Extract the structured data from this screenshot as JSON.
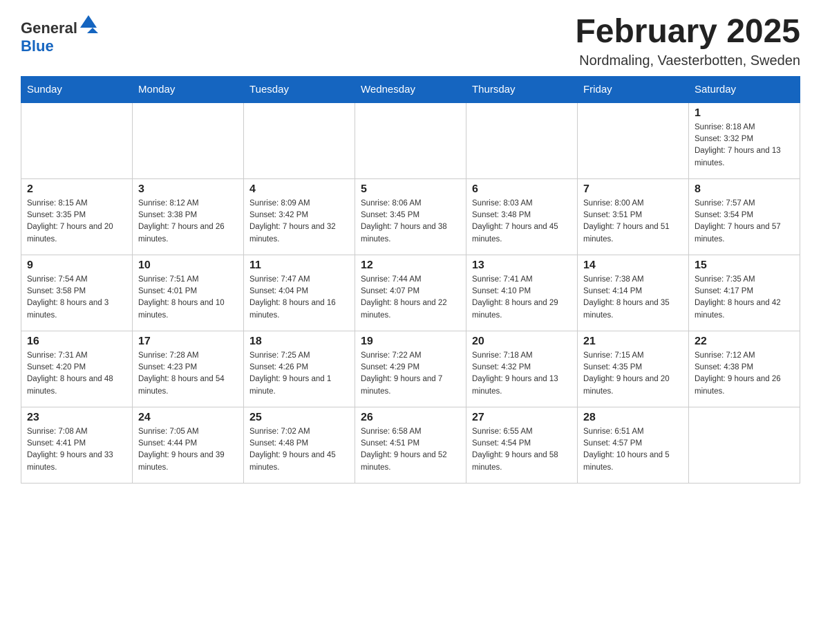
{
  "header": {
    "logo_general": "General",
    "logo_blue": "Blue",
    "month_title": "February 2025",
    "location": "Nordmaling, Vaesterbotten, Sweden"
  },
  "days_of_week": [
    "Sunday",
    "Monday",
    "Tuesday",
    "Wednesday",
    "Thursday",
    "Friday",
    "Saturday"
  ],
  "weeks": [
    [
      {
        "day": "",
        "sunrise": "",
        "sunset": "",
        "daylight": ""
      },
      {
        "day": "",
        "sunrise": "",
        "sunset": "",
        "daylight": ""
      },
      {
        "day": "",
        "sunrise": "",
        "sunset": "",
        "daylight": ""
      },
      {
        "day": "",
        "sunrise": "",
        "sunset": "",
        "daylight": ""
      },
      {
        "day": "",
        "sunrise": "",
        "sunset": "",
        "daylight": ""
      },
      {
        "day": "",
        "sunrise": "",
        "sunset": "",
        "daylight": ""
      },
      {
        "day": "1",
        "sunrise": "Sunrise: 8:18 AM",
        "sunset": "Sunset: 3:32 PM",
        "daylight": "Daylight: 7 hours and 13 minutes."
      }
    ],
    [
      {
        "day": "2",
        "sunrise": "Sunrise: 8:15 AM",
        "sunset": "Sunset: 3:35 PM",
        "daylight": "Daylight: 7 hours and 20 minutes."
      },
      {
        "day": "3",
        "sunrise": "Sunrise: 8:12 AM",
        "sunset": "Sunset: 3:38 PM",
        "daylight": "Daylight: 7 hours and 26 minutes."
      },
      {
        "day": "4",
        "sunrise": "Sunrise: 8:09 AM",
        "sunset": "Sunset: 3:42 PM",
        "daylight": "Daylight: 7 hours and 32 minutes."
      },
      {
        "day": "5",
        "sunrise": "Sunrise: 8:06 AM",
        "sunset": "Sunset: 3:45 PM",
        "daylight": "Daylight: 7 hours and 38 minutes."
      },
      {
        "day": "6",
        "sunrise": "Sunrise: 8:03 AM",
        "sunset": "Sunset: 3:48 PM",
        "daylight": "Daylight: 7 hours and 45 minutes."
      },
      {
        "day": "7",
        "sunrise": "Sunrise: 8:00 AM",
        "sunset": "Sunset: 3:51 PM",
        "daylight": "Daylight: 7 hours and 51 minutes."
      },
      {
        "day": "8",
        "sunrise": "Sunrise: 7:57 AM",
        "sunset": "Sunset: 3:54 PM",
        "daylight": "Daylight: 7 hours and 57 minutes."
      }
    ],
    [
      {
        "day": "9",
        "sunrise": "Sunrise: 7:54 AM",
        "sunset": "Sunset: 3:58 PM",
        "daylight": "Daylight: 8 hours and 3 minutes."
      },
      {
        "day": "10",
        "sunrise": "Sunrise: 7:51 AM",
        "sunset": "Sunset: 4:01 PM",
        "daylight": "Daylight: 8 hours and 10 minutes."
      },
      {
        "day": "11",
        "sunrise": "Sunrise: 7:47 AM",
        "sunset": "Sunset: 4:04 PM",
        "daylight": "Daylight: 8 hours and 16 minutes."
      },
      {
        "day": "12",
        "sunrise": "Sunrise: 7:44 AM",
        "sunset": "Sunset: 4:07 PM",
        "daylight": "Daylight: 8 hours and 22 minutes."
      },
      {
        "day": "13",
        "sunrise": "Sunrise: 7:41 AM",
        "sunset": "Sunset: 4:10 PM",
        "daylight": "Daylight: 8 hours and 29 minutes."
      },
      {
        "day": "14",
        "sunrise": "Sunrise: 7:38 AM",
        "sunset": "Sunset: 4:14 PM",
        "daylight": "Daylight: 8 hours and 35 minutes."
      },
      {
        "day": "15",
        "sunrise": "Sunrise: 7:35 AM",
        "sunset": "Sunset: 4:17 PM",
        "daylight": "Daylight: 8 hours and 42 minutes."
      }
    ],
    [
      {
        "day": "16",
        "sunrise": "Sunrise: 7:31 AM",
        "sunset": "Sunset: 4:20 PM",
        "daylight": "Daylight: 8 hours and 48 minutes."
      },
      {
        "day": "17",
        "sunrise": "Sunrise: 7:28 AM",
        "sunset": "Sunset: 4:23 PM",
        "daylight": "Daylight: 8 hours and 54 minutes."
      },
      {
        "day": "18",
        "sunrise": "Sunrise: 7:25 AM",
        "sunset": "Sunset: 4:26 PM",
        "daylight": "Daylight: 9 hours and 1 minute."
      },
      {
        "day": "19",
        "sunrise": "Sunrise: 7:22 AM",
        "sunset": "Sunset: 4:29 PM",
        "daylight": "Daylight: 9 hours and 7 minutes."
      },
      {
        "day": "20",
        "sunrise": "Sunrise: 7:18 AM",
        "sunset": "Sunset: 4:32 PM",
        "daylight": "Daylight: 9 hours and 13 minutes."
      },
      {
        "day": "21",
        "sunrise": "Sunrise: 7:15 AM",
        "sunset": "Sunset: 4:35 PM",
        "daylight": "Daylight: 9 hours and 20 minutes."
      },
      {
        "day": "22",
        "sunrise": "Sunrise: 7:12 AM",
        "sunset": "Sunset: 4:38 PM",
        "daylight": "Daylight: 9 hours and 26 minutes."
      }
    ],
    [
      {
        "day": "23",
        "sunrise": "Sunrise: 7:08 AM",
        "sunset": "Sunset: 4:41 PM",
        "daylight": "Daylight: 9 hours and 33 minutes."
      },
      {
        "day": "24",
        "sunrise": "Sunrise: 7:05 AM",
        "sunset": "Sunset: 4:44 PM",
        "daylight": "Daylight: 9 hours and 39 minutes."
      },
      {
        "day": "25",
        "sunrise": "Sunrise: 7:02 AM",
        "sunset": "Sunset: 4:48 PM",
        "daylight": "Daylight: 9 hours and 45 minutes."
      },
      {
        "day": "26",
        "sunrise": "Sunrise: 6:58 AM",
        "sunset": "Sunset: 4:51 PM",
        "daylight": "Daylight: 9 hours and 52 minutes."
      },
      {
        "day": "27",
        "sunrise": "Sunrise: 6:55 AM",
        "sunset": "Sunset: 4:54 PM",
        "daylight": "Daylight: 9 hours and 58 minutes."
      },
      {
        "day": "28",
        "sunrise": "Sunrise: 6:51 AM",
        "sunset": "Sunset: 4:57 PM",
        "daylight": "Daylight: 10 hours and 5 minutes."
      },
      {
        "day": "",
        "sunrise": "",
        "sunset": "",
        "daylight": ""
      }
    ]
  ]
}
